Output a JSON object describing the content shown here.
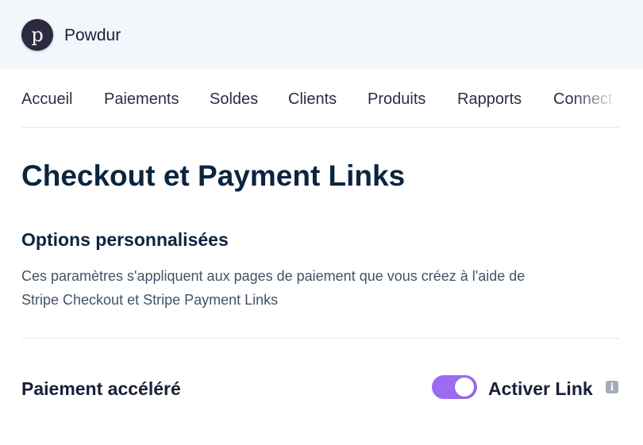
{
  "header": {
    "logo_letter": "p",
    "brand_name": "Powdur"
  },
  "nav": {
    "items": [
      {
        "label": "Accueil"
      },
      {
        "label": "Paiements"
      },
      {
        "label": "Soldes"
      },
      {
        "label": "Clients"
      },
      {
        "label": "Produits"
      },
      {
        "label": "Rapports"
      },
      {
        "label": "Connect"
      }
    ]
  },
  "main": {
    "page_title": "Checkout et Payment Links",
    "section_title": "Options personnalisées",
    "section_description": "Ces paramètres s'appliquent aux pages de paiement que vous créez à l'aide de Stripe Checkout et Stripe Payment Links",
    "setting": {
      "label": "Paiement accéléré",
      "toggle_label": "Activer Link",
      "toggle_on": true,
      "info_icon": "info-icon"
    }
  },
  "colors": {
    "header_bg": "#f3f6fa",
    "accent_toggle": "#9c6bf2",
    "title": "#0a2540",
    "body_text": "#425466"
  }
}
